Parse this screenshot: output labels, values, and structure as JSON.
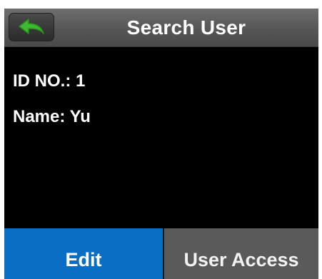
{
  "header": {
    "title": "Search User",
    "back_icon": "back-arrow-icon",
    "back_icon_color": "#3dbb2f"
  },
  "user": {
    "id_label": "ID NO.:",
    "id_value": "1",
    "name_label": "Name:",
    "name_value": "Yu"
  },
  "footer": {
    "edit_label": "Edit",
    "access_label": "User Access",
    "edit_color": "#0a6fc4",
    "access_color": "#5a5a5a"
  }
}
